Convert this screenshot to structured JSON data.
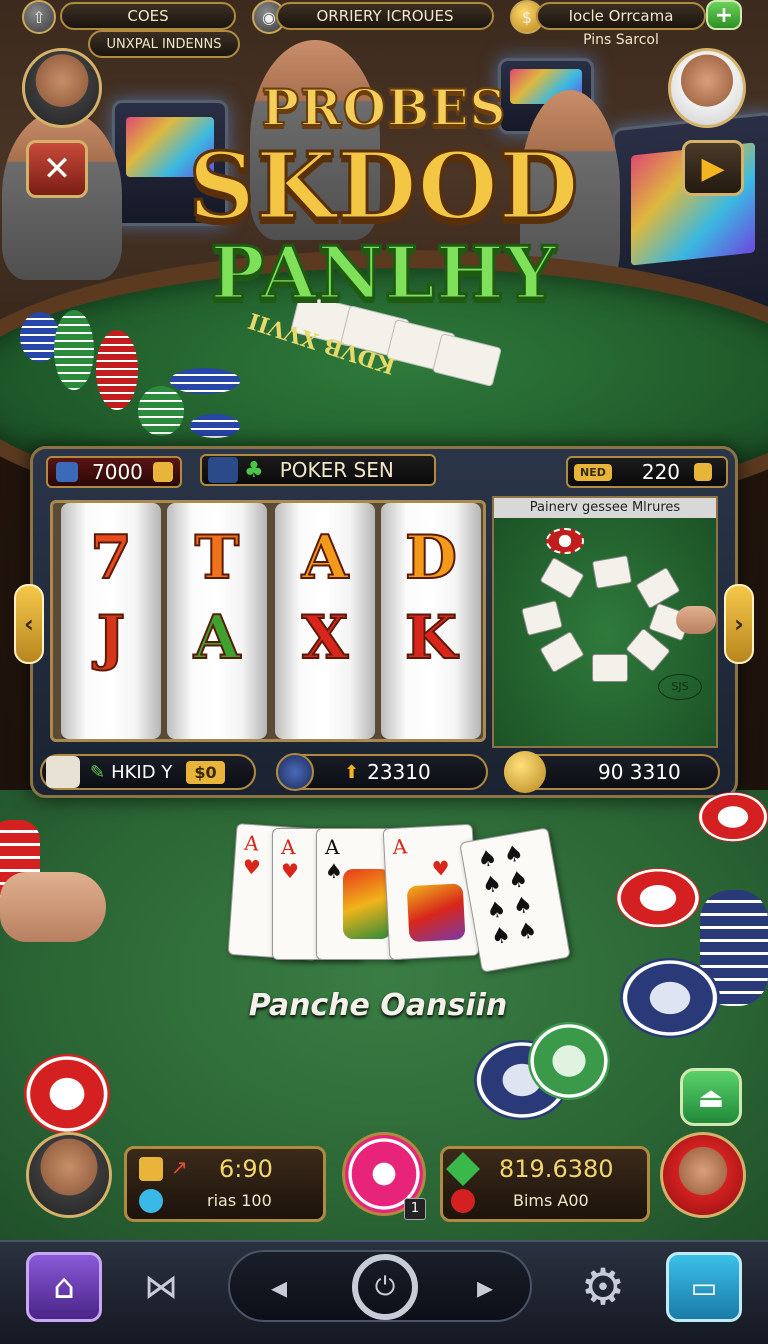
{
  "topbar": {
    "left_pill": "COES",
    "left_sub": "UNXPAL INDENNS",
    "center_pill": "ORRIERY ICROUES",
    "right_pill": "Iocle Orrcama",
    "right_sub": "Pins Sarcol"
  },
  "logo": {
    "line1": "PROBES",
    "line2": "SKDOD",
    "line3": "PANLHY",
    "table_text": "KDVB XVVII"
  },
  "panel": {
    "credits": "7000",
    "game_name": "POKER SEN",
    "bet_badge": "NED",
    "bet_value": "220",
    "side_title": "Painerv gessee Mlrures",
    "side_stamp": "SJS",
    "reels": [
      {
        "top": "7",
        "mid": "J",
        "top_color": "#e64a1e",
        "mid_color": "#d8361a"
      },
      {
        "top": "T",
        "mid": "A",
        "top_color": "#f0731c",
        "mid_color": "#3da32e"
      },
      {
        "top": "A",
        "mid": "X",
        "top_color": "#f39a1a",
        "mid_color": "#d8261a"
      },
      {
        "top": "D",
        "mid": "K",
        "top_color": "#f39a1a",
        "mid_color": "#d8261a"
      }
    ],
    "bottom": {
      "hold_label": "HKID Y",
      "hold_value": "$0",
      "win_value": "23310",
      "total_value": "90 3310"
    }
  },
  "table": {
    "caption": "Panche Oansiin",
    "cards": [
      {
        "rank": "A",
        "suit": "♥",
        "color": "#d8261a"
      },
      {
        "rank": "A",
        "suit": "♥",
        "color": "#d8261a"
      },
      {
        "rank": "A",
        "suit": "♠",
        "color": "#111111"
      },
      {
        "rank": "A",
        "suit": "♥",
        "color": "#d8261a"
      },
      {
        "rank": "",
        "suit": "♠",
        "color": "#111111"
      }
    ]
  },
  "hud": {
    "left_main": "6:90",
    "left_sub": "rias 100",
    "chip_badge": "1",
    "right_main": "819.6380",
    "right_sub": "Bims A00"
  },
  "colors": {
    "accent_gold": "#d4b26a",
    "felt_green": "#2b6635",
    "panel_blue": "#1b2332",
    "nav_purple": "#6a3aa8",
    "nav_teal": "#2a8fb0"
  },
  "icons": {
    "back": "up-arrow-icon",
    "close": "close-x-icon",
    "play": "play-icon",
    "add": "plus-icon",
    "home": "home-icon",
    "settings": "gear-icon",
    "wallet": "wallet-icon",
    "power": "power-icon",
    "eject": "eject-icon"
  }
}
